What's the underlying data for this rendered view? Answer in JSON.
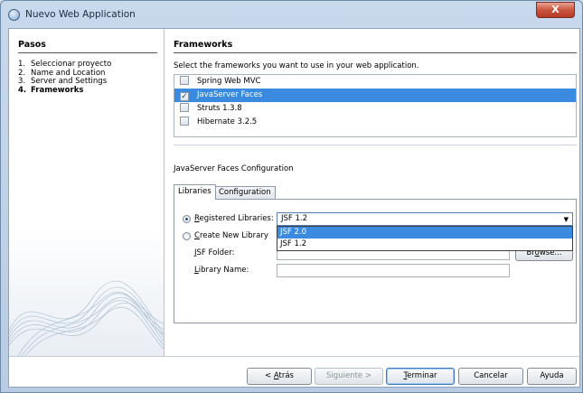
{
  "window": {
    "title": "Nuevo Web Application",
    "close_label": "X"
  },
  "steps": {
    "title": "Pasos",
    "items": [
      {
        "num": "1.",
        "label": "Seleccionar proyecto"
      },
      {
        "num": "2.",
        "label": "Name and Location"
      },
      {
        "num": "3.",
        "label": "Server and Settings"
      },
      {
        "num": "4.",
        "label": "Frameworks"
      }
    ],
    "current_index": 3
  },
  "main": {
    "title": "Frameworks",
    "instruction": "Select the frameworks you want to use in your web application.",
    "frameworks": [
      {
        "label": "Spring Web MVC",
        "checked": false,
        "selected": false
      },
      {
        "label": "JavaServer Faces",
        "checked": true,
        "selected": true
      },
      {
        "label": "Struts 1.3.8",
        "checked": false,
        "selected": false
      },
      {
        "label": "Hibernate 3.2.5",
        "checked": false,
        "selected": false
      }
    ],
    "config_title": "JavaServer Faces Configuration",
    "tabs": [
      {
        "label": "Libraries",
        "active": true
      },
      {
        "label": "Configuration",
        "active": false
      }
    ],
    "libraries": {
      "registered_label": "Registered Libraries:",
      "create_label": "Create New Library",
      "selected_option": "registered",
      "combo_value": "JSF 1.2",
      "options": [
        "JSF 2.0",
        "JSF 1.2"
      ],
      "highlighted_option": "JSF 2.0",
      "jsf_folder_label": "JSF Folder:",
      "jsf_folder_value": "",
      "library_name_label": "Library Name:",
      "library_name_value": "",
      "browse_label": "Browse..."
    }
  },
  "buttons": {
    "back": "< Atrás",
    "next": "Siguiente >",
    "finish": "Terminar",
    "cancel": "Cancelar",
    "help": "Ayuda"
  }
}
